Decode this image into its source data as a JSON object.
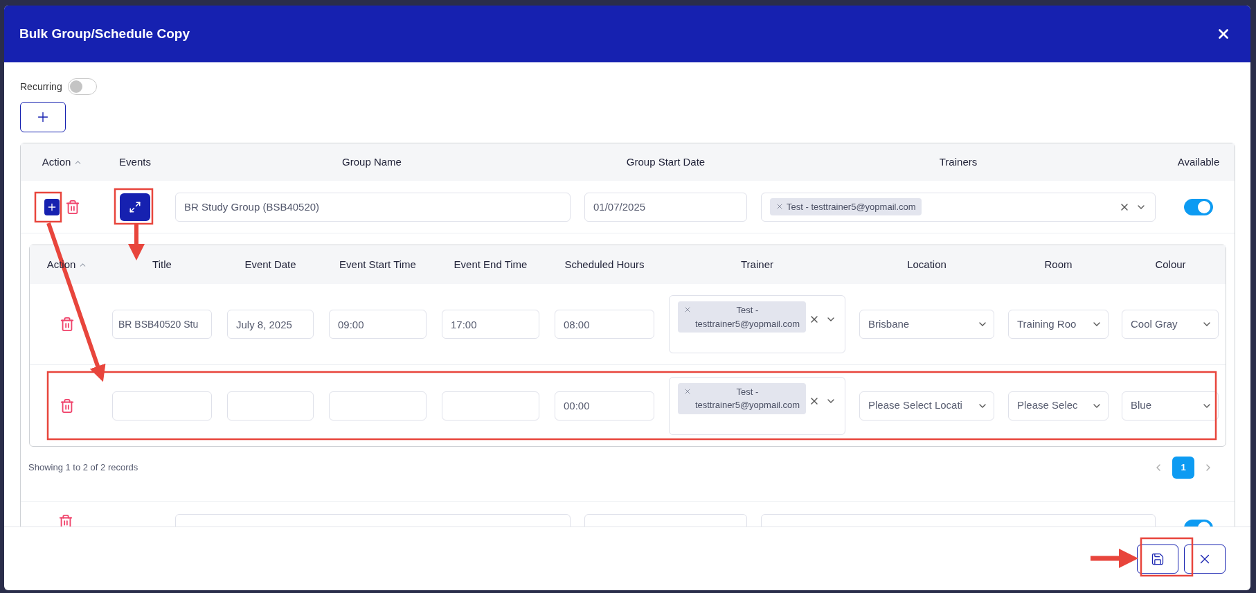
{
  "dialog": {
    "title": "Bulk Group/Schedule Copy"
  },
  "recurring": {
    "label": "Recurring",
    "on": false
  },
  "groups_table": {
    "columns": [
      {
        "label": "Action",
        "sortable": true
      },
      {
        "label": "Events",
        "sortable": false
      },
      {
        "label": "Group Name",
        "sortable": false
      },
      {
        "label": "Group Start Date",
        "sortable": false
      },
      {
        "label": "Trainers",
        "sortable": false
      },
      {
        "label": "Available",
        "sortable": false
      }
    ],
    "rows": [
      {
        "group_name": "BR Study Group (BSB40520)",
        "start_date": "01/07/2025",
        "trainers": [
          "Test - testtrainer5@yopmail.com"
        ],
        "available": true,
        "events_table": {
          "columns": [
            {
              "label": "Action",
              "sortable": true
            },
            {
              "label": "Title",
              "sortable": false
            },
            {
              "label": "Event Date",
              "sortable": false
            },
            {
              "label": "Event Start Time",
              "sortable": false
            },
            {
              "label": "Event End Time",
              "sortable": false
            },
            {
              "label": "Scheduled Hours",
              "sortable": false
            },
            {
              "label": "Trainer",
              "sortable": false
            },
            {
              "label": "Location",
              "sortable": false
            },
            {
              "label": "Room",
              "sortable": false
            },
            {
              "label": "Colour",
              "sortable": false
            }
          ],
          "rows": [
            {
              "title": "BR BSB40520 Stu",
              "event_date": "July 8, 2025",
              "start_time": "09:00",
              "end_time": "17:00",
              "scheduled_hours": "08:00",
              "trainers": [
                "Test - testtrainer5@yopmail.com"
              ],
              "location": "Brisbane",
              "room": "Training Roo",
              "colour": "Cool Gray"
            },
            {
              "scheduled_hours": "00:00",
              "trainers": [
                "Test - testtrainer5@yopmail.com"
              ],
              "location_placeholder": "Please Select Locati",
              "room_placeholder": "Please Selec",
              "colour": "Blue"
            }
          ],
          "summary": "Showing 1 to 2 of 2 records",
          "pages": [
            {
              "label": "1",
              "selected": true
            }
          ]
        }
      },
      {
        "available": true
      }
    ]
  }
}
